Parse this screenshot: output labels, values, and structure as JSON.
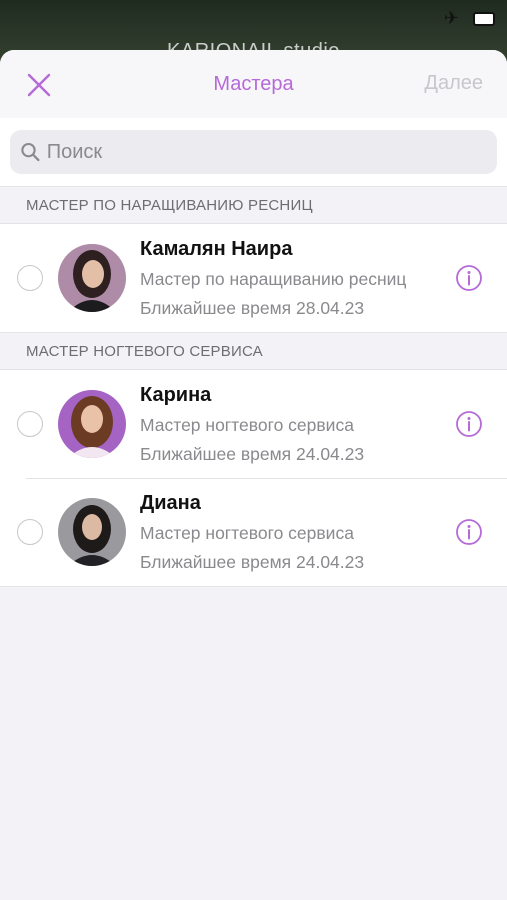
{
  "backdrop": {
    "title": "KARIONAIL studio"
  },
  "nav": {
    "title": "Мастера",
    "next_label": "Далее"
  },
  "search": {
    "placeholder": "Поиск",
    "value": ""
  },
  "sections": [
    {
      "header": "МАСТЕР ПО НАРАЩИВАНИЮ РЕСНИЦ",
      "items": [
        {
          "name": "Камалян Наира",
          "role": "Мастер по наращиванию ресниц",
          "nearest": "Ближайшее время 28.04.23"
        }
      ]
    },
    {
      "header": "МАСТЕР НОГТЕВОГО СЕРВИСА",
      "items": [
        {
          "name": "Карина",
          "role": "Мастер ногтевого сервиса",
          "nearest": "Ближайшее время 24.04.23"
        },
        {
          "name": "Диана",
          "role": "Мастер ногтевого сервиса",
          "nearest": "Ближайшее время 24.04.23"
        }
      ]
    }
  ],
  "colors": {
    "accent": "#b56ad8",
    "disabled": "#c8c8cc",
    "secondary_text": "#8a8a8e"
  }
}
